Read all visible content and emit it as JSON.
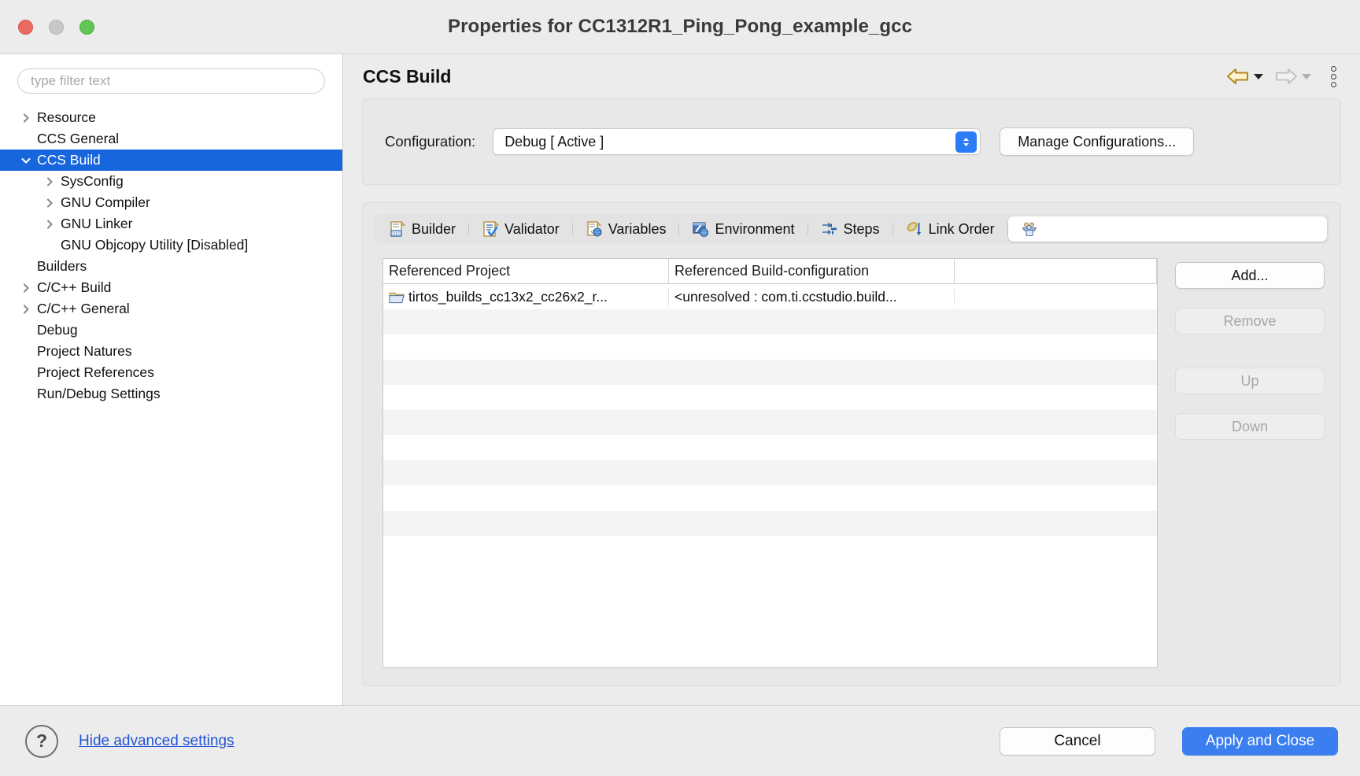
{
  "window": {
    "title": "Properties for CC1312R1_Ping_Pong_example_gcc",
    "traffic_lights": {
      "close": "close",
      "minimize": "minimize",
      "maximize": "maximize"
    }
  },
  "sidebar": {
    "filter": {
      "placeholder": "type filter text",
      "value": ""
    },
    "tree": [
      {
        "label": "Resource",
        "level": 0,
        "twisty": "collapsed",
        "selected": false
      },
      {
        "label": "CCS General",
        "level": 0,
        "twisty": "none",
        "selected": false
      },
      {
        "label": "CCS Build",
        "level": 0,
        "twisty": "expanded",
        "selected": true
      },
      {
        "label": "SysConfig",
        "level": 1,
        "twisty": "collapsed",
        "selected": false
      },
      {
        "label": "GNU Compiler",
        "level": 1,
        "twisty": "collapsed",
        "selected": false
      },
      {
        "label": "GNU Linker",
        "level": 1,
        "twisty": "collapsed",
        "selected": false
      },
      {
        "label": "GNU Objcopy Utility  [Disabled]",
        "level": 1,
        "twisty": "none",
        "selected": false
      },
      {
        "label": "Builders",
        "level": 0,
        "twisty": "none",
        "selected": false
      },
      {
        "label": "C/C++ Build",
        "level": 0,
        "twisty": "collapsed",
        "selected": false
      },
      {
        "label": "C/C++ General",
        "level": 0,
        "twisty": "collapsed",
        "selected": false
      },
      {
        "label": "Debug",
        "level": 0,
        "twisty": "none",
        "selected": false
      },
      {
        "label": "Project Natures",
        "level": 0,
        "twisty": "none",
        "selected": false
      },
      {
        "label": "Project References",
        "level": 0,
        "twisty": "none",
        "selected": false
      },
      {
        "label": "Run/Debug Settings",
        "level": 0,
        "twisty": "none",
        "selected": false
      }
    ]
  },
  "header": {
    "page_title": "CCS Build",
    "nav": {
      "back": "back-arrow",
      "back_enabled": true,
      "forward": "forward-arrow",
      "forward_enabled": false,
      "menu": "view-menu"
    }
  },
  "configuration": {
    "label": "Configuration:",
    "selected": "Debug  [ Active ]",
    "options": [
      "Debug  [ Active ]"
    ],
    "manage_button": "Manage Configurations..."
  },
  "tabs": [
    {
      "label": "Builder",
      "icon": "builder-icon",
      "selected": false
    },
    {
      "label": "Validator",
      "icon": "validator-icon",
      "selected": false
    },
    {
      "label": "Variables",
      "icon": "variables-icon",
      "selected": false
    },
    {
      "label": "Environment",
      "icon": "environment-icon",
      "selected": false
    },
    {
      "label": "Steps",
      "icon": "steps-icon",
      "selected": false
    },
    {
      "label": "Link Order",
      "icon": "link-order-icon",
      "selected": false
    },
    {
      "label": "",
      "icon": "dependencies-icon",
      "selected": true
    }
  ],
  "table": {
    "columns": [
      "Referenced Project",
      "Referenced Build-configuration",
      ""
    ],
    "rows": [
      {
        "icon": "folder-icon",
        "project": "tirtos_builds_cc13x2_cc26x2_r...",
        "build_configuration": "<unresolved : com.ti.ccstudio.build...",
        "extra": ""
      }
    ],
    "empty_row_count": 10
  },
  "side_buttons": [
    {
      "label": "Add...",
      "enabled": true
    },
    {
      "label": "Remove",
      "enabled": false
    },
    {
      "label": "Up",
      "enabled": false
    },
    {
      "label": "Down",
      "enabled": false
    }
  ],
  "footer": {
    "help_icon": "help-icon",
    "help_glyph": "?",
    "advanced_link": "Hide advanced settings",
    "cancel": "Cancel",
    "apply_and_close": "Apply and Close"
  },
  "colors": {
    "selection_blue": "#1766dd",
    "primary_button": "#3b7ef0",
    "link_blue": "#2255d6",
    "stepper_blue": "#2b7cf6",
    "back_arrow_gold": "#c8941e",
    "window_chrome": "#ececec"
  }
}
